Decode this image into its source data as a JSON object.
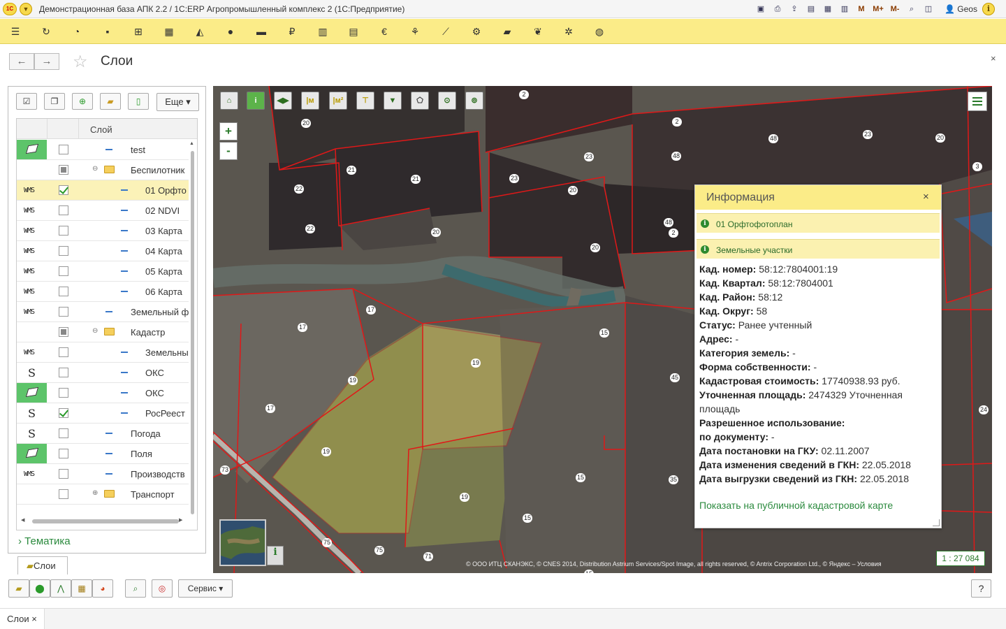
{
  "app": {
    "title": "Демонстрационная база АПК 2.2 / 1C:ERP Агропромышленный комплекс 2   (1С:Предприятие)",
    "logo_text": "1С",
    "user": "Geos"
  },
  "title_icons": [
    "save-icon",
    "print-icon",
    "export-icon",
    "print-preview-icon",
    "calculator-icon",
    "calendar-icon",
    "M",
    "M+",
    "M-",
    "search-icon",
    "panel-icon"
  ],
  "section_icons": [
    "menu-icon",
    "history-icon",
    "reports-icon",
    "bag-icon",
    "cart-icon",
    "grid-icon",
    "factory-icon",
    "person-icon",
    "card-icon",
    "ruble-icon",
    "chart-icon",
    "calculator-icon",
    "euro-icon",
    "plant-icon",
    "field-icon",
    "tractor-icon",
    "truck-icon",
    "harvest-icon",
    "gear-icon",
    "globe-icon"
  ],
  "form": {
    "title": "Слои",
    "close": "×"
  },
  "left_panel": {
    "more_button": "Еще",
    "column_header": "Слой",
    "rows": [
      {
        "icon": "polygon",
        "green": true,
        "checked": "no",
        "indent": 1,
        "label": "test"
      },
      {
        "icon": "none",
        "green": false,
        "checked": "ind",
        "indent": 1,
        "folder": true,
        "toggle": "⊖",
        "label": "Беспилотник"
      },
      {
        "icon": "wms",
        "green": false,
        "checked": "yes",
        "indent": 2,
        "label": "01 Орфто",
        "selected": true
      },
      {
        "icon": "wms",
        "green": false,
        "checked": "no",
        "indent": 2,
        "label": "02 NDVI"
      },
      {
        "icon": "wms",
        "green": false,
        "checked": "no",
        "indent": 2,
        "label": "03 Карта"
      },
      {
        "icon": "wms",
        "green": false,
        "checked": "no",
        "indent": 2,
        "label": "04 Карта"
      },
      {
        "icon": "wms",
        "green": false,
        "checked": "no",
        "indent": 2,
        "label": "05 Карта"
      },
      {
        "icon": "wms",
        "green": false,
        "checked": "no",
        "indent": 2,
        "label": "06 Карта"
      },
      {
        "icon": "wms",
        "green": false,
        "checked": "no",
        "indent": 1,
        "label": "Земельный ф"
      },
      {
        "icon": "none",
        "green": false,
        "checked": "ind",
        "indent": 1,
        "folder": true,
        "toggle": "⊖",
        "label": "Кадастр"
      },
      {
        "icon": "wms",
        "green": false,
        "checked": "no",
        "indent": 2,
        "label": "Земельны"
      },
      {
        "icon": "s",
        "green": false,
        "checked": "no",
        "indent": 2,
        "label": "ОКС"
      },
      {
        "icon": "polygon",
        "green": true,
        "checked": "no",
        "indent": 2,
        "label": "ОКС"
      },
      {
        "icon": "s",
        "green": false,
        "checked": "yes",
        "indent": 2,
        "label": "РосРеест"
      },
      {
        "icon": "s",
        "green": false,
        "checked": "no",
        "indent": 1,
        "label": "Погода"
      },
      {
        "icon": "polygon",
        "green": true,
        "checked": "no",
        "indent": 1,
        "label": "Поля"
      },
      {
        "icon": "wms",
        "green": false,
        "checked": "no",
        "indent": 1,
        "label": "Производств"
      },
      {
        "icon": "none",
        "green": false,
        "checked": "no",
        "indent": 1,
        "folder": true,
        "toggle": "⊕",
        "label": "Транспорт"
      }
    ],
    "thematics": "Тематика",
    "tab_layers": "Слои"
  },
  "map": {
    "zoom_in": "+",
    "zoom_out": "-",
    "info_button": "i",
    "copyright": "© ООО ИТЦ СКАНЭКС, © CNES 2014, Distribution Astrium Services/Spot Image, all rights reserved, © Antrix Corporation Ltd., © Яндекс – Условия",
    "scale": "1 : 27 084",
    "tools": [
      "home-icon",
      "info-icon",
      "pan-icon",
      "measure-length-icon",
      "measure-area-icon",
      "measure-icon",
      "filter-icon",
      "select-polygon-icon",
      "location-icon",
      "location-down-icon"
    ],
    "parcel_labels": [
      "2",
      "20",
      "2",
      "48",
      "23",
      "20",
      "21",
      "21",
      "23",
      "48",
      "22",
      "23",
      "20",
      "22",
      "20",
      "2",
      "48",
      "20",
      "17",
      "17",
      "15",
      "19",
      "19",
      "45",
      "17",
      "19",
      "35",
      "24",
      "19",
      "15",
      "73",
      "15",
      "75",
      "75",
      "71",
      "15",
      "3"
    ]
  },
  "info_panel": {
    "title": "Информация",
    "close": "×",
    "sections": [
      "01 Орфтофотоплан",
      "Земельные участки"
    ],
    "properties": [
      {
        "k": "Кад. номер:",
        "v": "58:12:7804001:19"
      },
      {
        "k": "Кад. Квартал:",
        "v": "58:12:7804001"
      },
      {
        "k": "Кад. Район:",
        "v": "58:12"
      },
      {
        "k": "Кад. Округ:",
        "v": "58"
      },
      {
        "k": "Статус:",
        "v": "Ранее учтенный"
      },
      {
        "k": "Адрес:",
        "v": "-"
      },
      {
        "k": "Категория земель:",
        "v": "-"
      },
      {
        "k": "Форма собственности:",
        "v": "-"
      },
      {
        "k": "Кадастровая стоимость:",
        "v": "17740938.93 руб."
      },
      {
        "k": "Уточненная площадь:",
        "v": "2474329 Уточненная площадь"
      },
      {
        "k": "Разрешенное использование:",
        "v": ""
      },
      {
        "k": "по документу:",
        "v": "-"
      },
      {
        "k": "Дата постановки на ГКУ:",
        "v": "02.11.2007"
      },
      {
        "k": "Дата изменения сведений в ГКН:",
        "v": "22.05.2018"
      },
      {
        "k": "Дата выгрузки сведений из ГКН:",
        "v": "22.05.2018"
      }
    ],
    "link": "Показать на публичной кадастровой карте"
  },
  "bottom": {
    "service_button": "Сервис",
    "help_button": "?",
    "tab": "Слои",
    "tab_close": "×"
  }
}
